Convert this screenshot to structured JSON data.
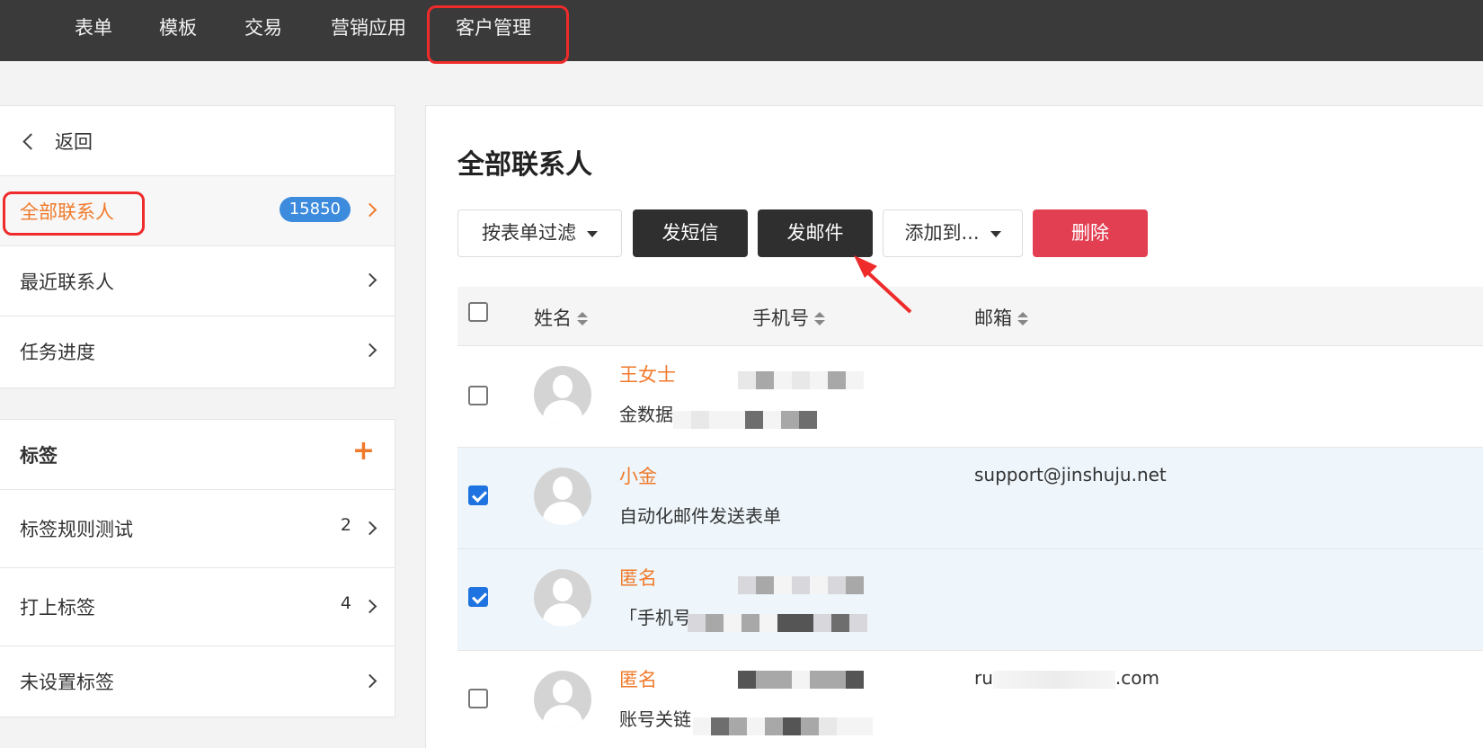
{
  "nav": {
    "items": [
      "表单",
      "模板",
      "交易",
      "营销应用",
      "客户管理"
    ]
  },
  "sidebar": {
    "back_label": "返回",
    "items": [
      {
        "label": "全部联系人",
        "badge": "15850"
      },
      {
        "label": "最近联系人"
      },
      {
        "label": "任务进度"
      }
    ],
    "tags_title": "标签",
    "tags": [
      {
        "label": "标签规则测试",
        "count": "2"
      },
      {
        "label": "打上标签",
        "count": "4"
      },
      {
        "label": "未设置标签"
      }
    ]
  },
  "main": {
    "title": "全部联系人",
    "toolbar": {
      "filter_label": "按表单过滤",
      "sms_label": "发短信",
      "email_label": "发邮件",
      "add_to_label": "添加到...",
      "delete_label": "删除"
    },
    "columns": {
      "name": "姓名",
      "phone": "手机号",
      "email": "邮箱"
    },
    "rows": [
      {
        "name": "王女士",
        "sub": "金数据",
        "email": "",
        "checked": false
      },
      {
        "name": "小金",
        "sub": "自动化邮件发送表单",
        "email": "support@jinshuju.net",
        "checked": true
      },
      {
        "name": "匿名",
        "sub": "「手机号",
        "email": "",
        "checked": true
      },
      {
        "name": "匿名",
        "sub": "账号关链",
        "email_prefix": "ru",
        "email_suffix": ".com",
        "checked": false
      }
    ]
  },
  "colors": {
    "accent": "#f07a2b",
    "highlight": "#ef2b2b",
    "badge": "#3c8bdd",
    "danger": "#e33f52",
    "nav_bg": "#3a3a3a"
  }
}
